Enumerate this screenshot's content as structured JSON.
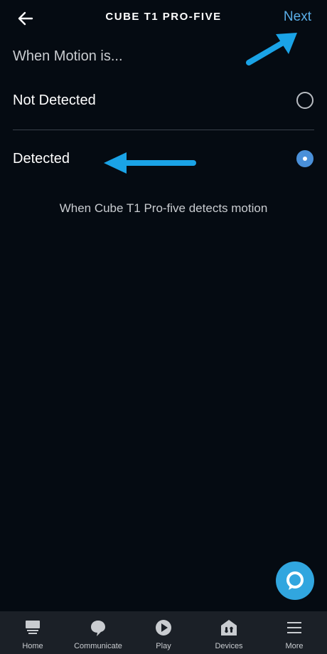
{
  "header": {
    "back_icon": "arrow-left-icon",
    "title": "CUBE T1 PRO-FIVE",
    "next_label": "Next"
  },
  "section_label": "When Motion is...",
  "options": [
    {
      "label": "Not Detected",
      "selected": false
    },
    {
      "label": "Detected",
      "selected": true
    }
  ],
  "description": "When Cube T1 Pro-five detects motion",
  "colors": {
    "background": "#050b12",
    "accent": "#5aaee8",
    "radio_selected": "#4a90d9",
    "annotation_arrow": "#1aa3e6",
    "alexa": "#31a6df",
    "nav_background": "#1b2027"
  },
  "alexa_icon": "alexa-ring-icon",
  "bottom_nav": [
    {
      "label": "Home",
      "icon": "home-icon"
    },
    {
      "label": "Communicate",
      "icon": "chat-bubble-icon"
    },
    {
      "label": "Play",
      "icon": "play-icon"
    },
    {
      "label": "Devices",
      "icon": "devices-icon"
    },
    {
      "label": "More",
      "icon": "menu-icon"
    }
  ]
}
